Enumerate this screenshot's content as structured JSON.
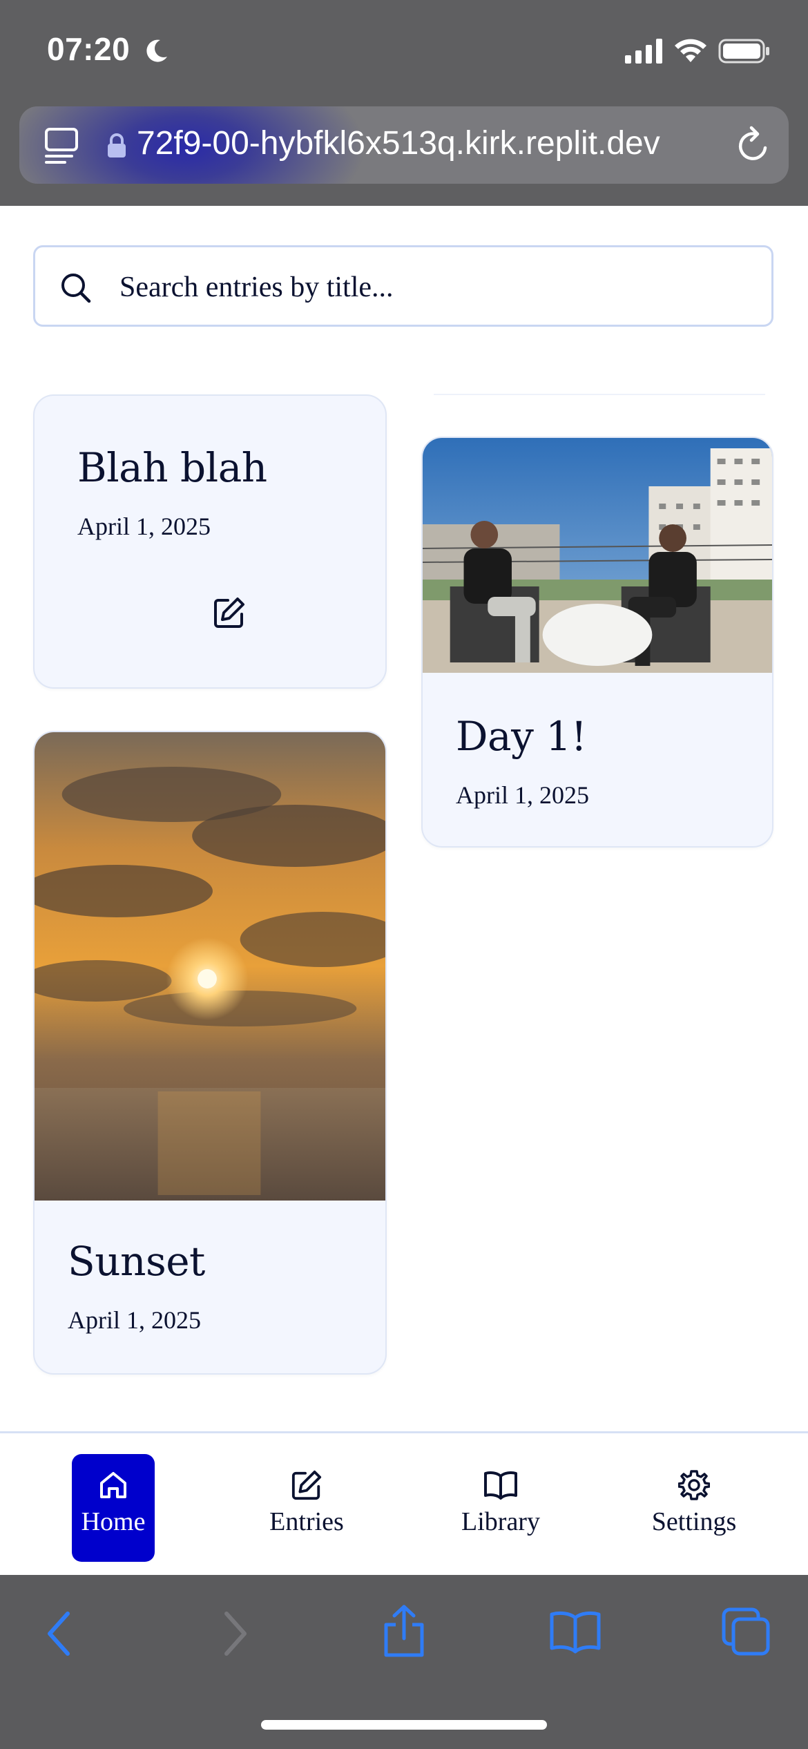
{
  "status_bar": {
    "time": "07:20",
    "icons": [
      "moon-icon",
      "signal-icon",
      "wifi-icon",
      "battery-icon"
    ]
  },
  "browser": {
    "url": "72f9-00-hybfkl6x513q.kirk.replit.dev",
    "icons": [
      "tabs-icon",
      "lock-icon",
      "reload-icon"
    ]
  },
  "search": {
    "placeholder": "Search entries by title...",
    "value": ""
  },
  "entries": [
    {
      "title": "Blah blah",
      "date": "April 1, 2025",
      "has_image": false,
      "image_desc": ""
    },
    {
      "title": "Day 1!",
      "date": "April 1, 2025",
      "has_image": true,
      "image_desc": "two-people-on-rooftop-patio"
    },
    {
      "title": "Sunset",
      "date": "April 1, 2025",
      "has_image": true,
      "image_desc": "sunset-over-ocean"
    }
  ],
  "nav": {
    "items": [
      {
        "label": "Home",
        "icon": "home-icon",
        "active": true
      },
      {
        "label": "Entries",
        "icon": "edit-icon",
        "active": false
      },
      {
        "label": "Library",
        "icon": "book-icon",
        "active": false
      },
      {
        "label": "Settings",
        "icon": "gear-icon",
        "active": false
      }
    ]
  },
  "safari_toolbar": {
    "icons": [
      "back-icon",
      "forward-icon",
      "share-icon",
      "bookmarks-icon",
      "tabs-overview-icon"
    ]
  },
  "colors": {
    "accent": "#0000cc",
    "card_bg": "#f3f6fe",
    "text": "#0b1230",
    "toolbar_icon": "#2f7cf6"
  }
}
